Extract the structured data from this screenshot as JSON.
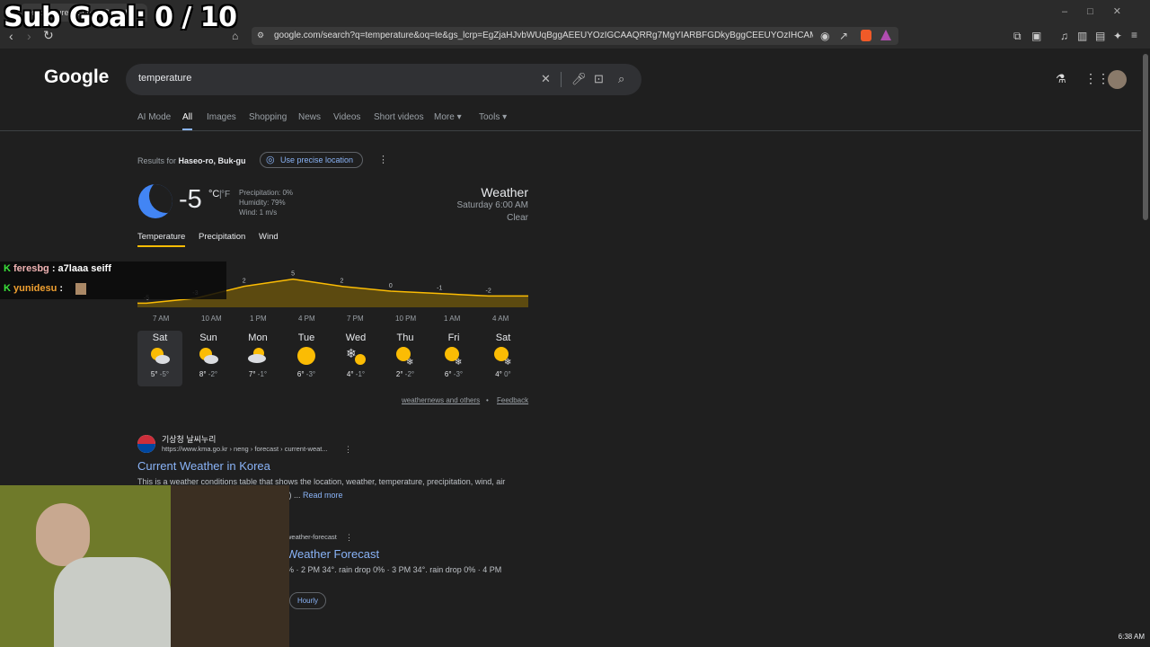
{
  "overlay": {
    "sub_goal": "Sub Goal:  0 / 10"
  },
  "browser": {
    "tab_title": "temperature - Google Search",
    "url": "google.com/search?q=temperature&oq=te&gs_lcrp=EgZjaHJvbWUqBggAEEUYOzIGCAAQRRg7MgYIARBFGDkyBggCEEUYOzIHCAMQABiPAjIGC..."
  },
  "google": {
    "logo": "Google",
    "query": "temperature",
    "nav": [
      "AI Mode",
      "All",
      "Images",
      "Shopping",
      "News",
      "Videos",
      "Short videos",
      "More",
      "Tools"
    ],
    "results_for_prefix": "Results for ",
    "results_for_location": "Haseo-ro, Buk-gu",
    "precise_location": "Use precise location"
  },
  "weather": {
    "current_temp": "-5",
    "unit_c": "°C",
    "unit_f": "°F",
    "precipitation": "Precipitation: 0%",
    "humidity": "Humidity: 79%",
    "wind": "Wind: 1 m/s",
    "title": "Weather",
    "time": "Saturday 6:00 AM",
    "condition": "Clear",
    "tabs": [
      "Temperature",
      "Precipitation",
      "Wind"
    ],
    "hours": [
      "7 AM",
      "10 AM",
      "1 PM",
      "4 PM",
      "7 PM",
      "10 PM",
      "1 AM",
      "4 AM"
    ],
    "hourly_labels": [
      "-5",
      "-3",
      "2",
      "5",
      "2",
      "0",
      "-1",
      "-2"
    ],
    "days": [
      {
        "name": "Sat",
        "hi": "5°",
        "lo": "-5°",
        "icon": "partly-cloudy-icon"
      },
      {
        "name": "Sun",
        "hi": "8°",
        "lo": "-2°",
        "icon": "partly-cloudy-icon"
      },
      {
        "name": "Mon",
        "hi": "7°",
        "lo": "-1°",
        "icon": "cloudy-icon"
      },
      {
        "name": "Tue",
        "hi": "6°",
        "lo": "-3°",
        "icon": "sunny-icon"
      },
      {
        "name": "Wed",
        "hi": "4°",
        "lo": "-1°",
        "icon": "snow-sun-icon"
      },
      {
        "name": "Thu",
        "hi": "2°",
        "lo": "-2°",
        "icon": "sun-snow-icon"
      },
      {
        "name": "Fri",
        "hi": "6°",
        "lo": "-3°",
        "icon": "sun-snow-icon"
      },
      {
        "name": "Sat",
        "hi": "4°",
        "lo": "0°",
        "icon": "sun-snow-icon"
      }
    ],
    "source": "weathernews and others",
    "feedback": "Feedback"
  },
  "result1": {
    "site_name": "기상청 날씨누리",
    "site_url": "https://www.kma.go.kr › neng › forecast › current-weat...",
    "title": "Current Weather in Korea",
    "snippet": "This is a weather conditions table that shows the location, weather, temperature, precipitation, wind, air",
    "snippet2": "C) ...",
    "read_more": "Read more"
  },
  "result2": {
    "url": "weather-forecast",
    "title": "Weather Forecast",
    "snippet": "% · 2 PM 34°. rain drop 0% · 3 PM 34°. rain drop 0% · 4 PM",
    "chip": "Hourly"
  },
  "chat": [
    {
      "user": "feresbg",
      "message": "a7laaa seiff"
    },
    {
      "user": "yunidesu",
      "message": ""
    }
  ],
  "taskbar": {
    "clock": "6:38 AM"
  },
  "colors": {
    "accent_link": "#8ab4f8",
    "chart_line": "#fbbc04",
    "background": "#1f1f1f"
  },
  "chart_data": {
    "type": "area",
    "x": [
      "7 AM",
      "10 AM",
      "1 PM",
      "4 PM",
      "7 PM",
      "10 PM",
      "1 AM",
      "4 AM"
    ],
    "values": [
      -5,
      -3,
      2,
      5,
      2,
      0,
      -1,
      -2
    ]
  }
}
